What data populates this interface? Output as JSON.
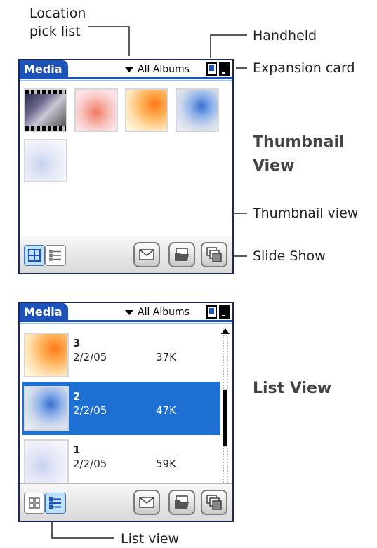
{
  "callouts": {
    "location_pick_list": "Location\npick list",
    "handheld": "Handheld",
    "expansion_card": "Expansion card",
    "thumbnail_view": "Thumbnail view",
    "slide_show": "Slide Show",
    "list_view": "List view"
  },
  "headings": {
    "thumbnail_view": "Thumbnail\nView",
    "list_view": "List View"
  },
  "app": {
    "title": "Media",
    "album_picker": "All Albums"
  },
  "list": {
    "items": [
      {
        "name": "3",
        "date": "2/2/05",
        "size": "37K",
        "selected": false
      },
      {
        "name": "2",
        "date": "2/2/05",
        "size": "47K",
        "selected": true
      },
      {
        "name": "1",
        "date": "2/2/05",
        "size": "59K",
        "selected": false
      }
    ]
  },
  "colors": {
    "accent": "#1d53b8",
    "selection": "#1d6fd1"
  },
  "icons": [
    "dropdown-triangle-icon",
    "handheld-icon",
    "expansion-card-icon",
    "thumbnail-grid-icon",
    "list-icon",
    "envelope-icon",
    "folder-icon",
    "slideshow-icon",
    "scroll-up-arrow-icon",
    "scroll-down-arrow-icon"
  ]
}
